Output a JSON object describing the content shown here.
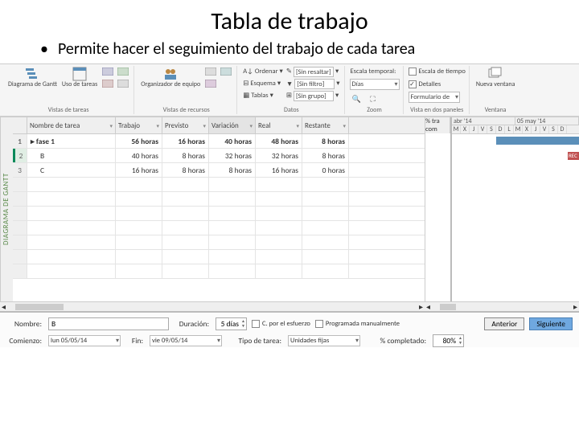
{
  "slide": {
    "title": "Tabla de trabajo",
    "bullet": "Permite hacer el seguimiento del trabajo de cada tarea"
  },
  "ribbon": {
    "views_tasks": {
      "gantt": "Diagrama de Gantt",
      "uso": "Uso de tareas",
      "label": "Vistas de tareas"
    },
    "views_res": {
      "org": "Organizador de equipo",
      "label": "Vistas de recursos"
    },
    "data": {
      "sort": "Ordenar",
      "outline": "Esquema",
      "tables": "Tablas",
      "highlight_lbl": "",
      "highlight_val": "[Sin resaltar]",
      "filter_lbl": "",
      "filter_val": "[Sin filtro]",
      "group_lbl": "",
      "group_val": "[Sin grupo]",
      "label": "Datos"
    },
    "zoom": {
      "timescale_lbl": "Escala temporal:",
      "timescale_val": "Días",
      "label": "Zoom"
    },
    "split": {
      "chk_timeline": "Escala de tiempo",
      "chk_details": "Detalles",
      "select_val": "Formulario de",
      "label": "Vista en dos paneles"
    },
    "window": {
      "new": "Nueva ventana",
      "label": "Ventana"
    }
  },
  "grid": {
    "vtab": "DIAGRAMA DE GANTT",
    "headers": {
      "task": "Nombre de tarea",
      "work": "Trabajo",
      "baseline": "Previsto",
      "variance": "Variación",
      "actual": "Real",
      "remaining": "Restante",
      "pct": "% tra com"
    },
    "rows": [
      {
        "n": "1",
        "task": "fase 1",
        "work": "56 horas",
        "baseline": "16 horas",
        "variance": "40 horas",
        "actual": "48 horas",
        "remaining": "8 horas",
        "bold": true
      },
      {
        "n": "2",
        "task": "B",
        "work": "40 horas",
        "baseline": "8 horas",
        "variance": "32 horas",
        "actual": "32 horas",
        "remaining": "8 horas",
        "sel": true
      },
      {
        "n": "3",
        "task": "C",
        "work": "16 horas",
        "baseline": "8 horas",
        "variance": "8 horas",
        "actual": "16 horas",
        "remaining": "0 horas"
      }
    ]
  },
  "timeline": {
    "periods": [
      "abr '14",
      "05 may '14"
    ],
    "days": [
      "M",
      "X",
      "J",
      "V",
      "S",
      "D",
      "L",
      "M",
      "X",
      "J",
      "V",
      "S",
      "D"
    ],
    "bar2_label": "REC"
  },
  "form": {
    "name_lbl": "Nombre:",
    "name_val": "B",
    "dur_lbl": "Duración:",
    "dur_val": "5 días",
    "effort_chk": "C. por el esfuerzo",
    "manual_chk": "Programada manualmente",
    "prev_btn": "Anterior",
    "next_btn": "Siguiente",
    "start_lbl": "Comienzo:",
    "start_val": "lun 05/05/14",
    "end_lbl": "Fin:",
    "end_val": "vie 09/05/14",
    "type_lbl": "Tipo de tarea:",
    "type_val": "Unidades fijas",
    "pct_lbl": "% completado:",
    "pct_val": "80%"
  }
}
